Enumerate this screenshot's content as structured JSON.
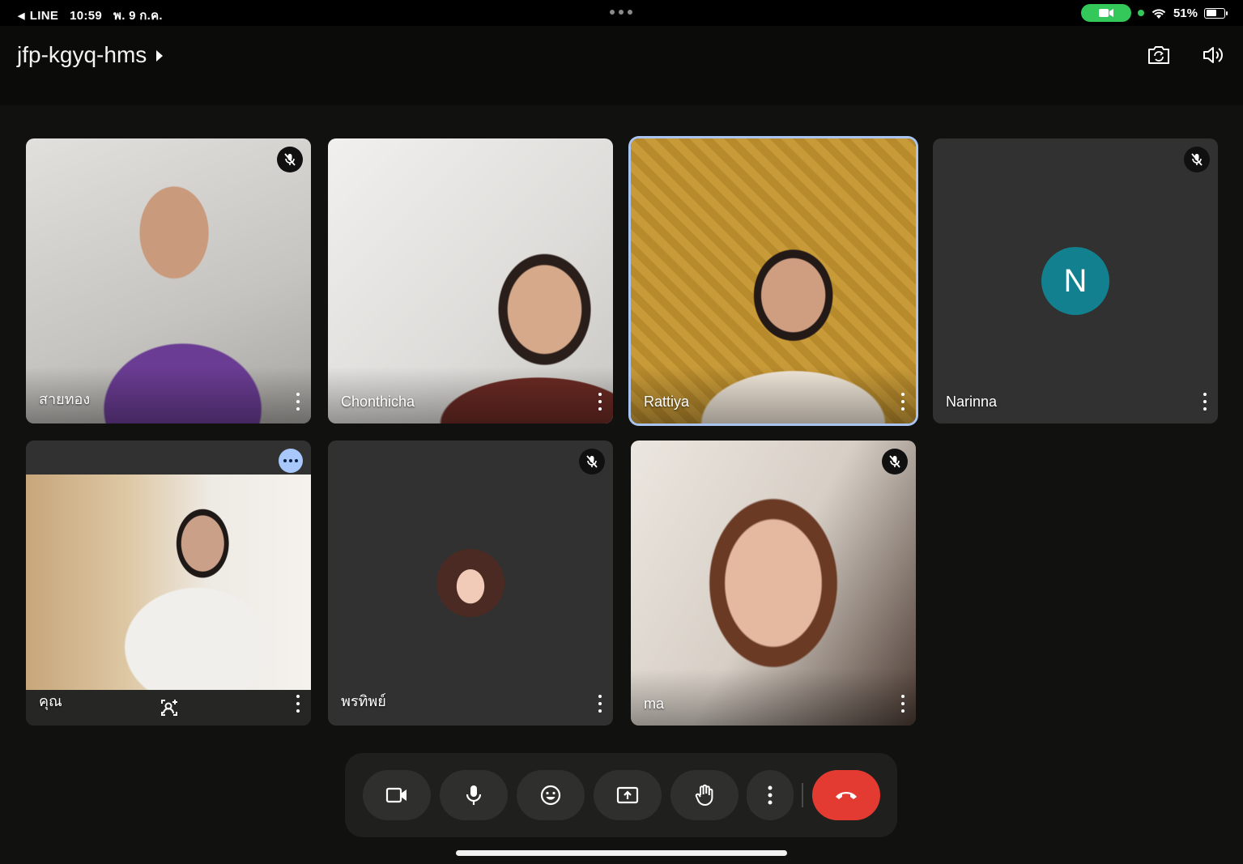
{
  "status_bar": {
    "back_app": "LINE",
    "time": "10:59",
    "date": "พ. 9 ก.ค.",
    "battery": "51%",
    "battery_level": 0.51
  },
  "meeting": {
    "code": "jfp-kgyq-hms"
  },
  "participants": [
    {
      "name": "สายทอง",
      "muted": true
    },
    {
      "name": "Chonthicha",
      "muted": false
    },
    {
      "name": "Rattiya",
      "muted": false,
      "active_speaker": true
    },
    {
      "name": "Narinna",
      "muted": true,
      "avatar_letter": "N",
      "avatar_color": "#12808e"
    },
    {
      "name": "คุณ",
      "muted": false,
      "is_self": true
    },
    {
      "name": "พรทิพย์",
      "muted": true
    },
    {
      "name": "ma",
      "muted": true
    }
  ],
  "controls": {
    "icons": [
      "video-camera-icon",
      "microphone-icon",
      "emoji-icon",
      "present-screen-icon",
      "raise-hand-icon",
      "more-options-icon",
      "end-call-icon"
    ],
    "end_call_color": "#e33b32"
  },
  "colors": {
    "active_border": "#aac4f2",
    "status_green": "#34c759",
    "self_menu": "#a8c7fa"
  }
}
